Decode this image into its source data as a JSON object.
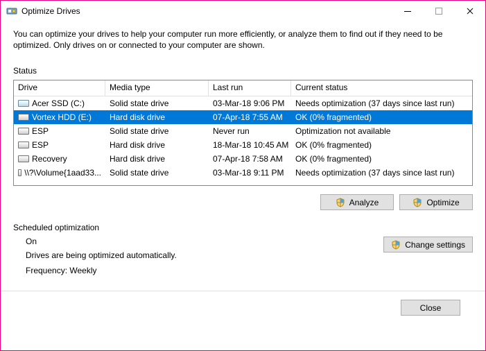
{
  "window": {
    "title": "Optimize Drives"
  },
  "intro": "You can optimize your drives to help your computer run more efficiently, or analyze them to find out if they need to be optimized. Only drives on or connected to your computer are shown.",
  "status": {
    "label": "Status",
    "columns": [
      "Drive",
      "Media type",
      "Last run",
      "Current status"
    ],
    "rows": [
      {
        "name": "Acer SSD (C:)",
        "media": "Solid state drive",
        "last": "03-Mar-18 9:06 PM",
        "status": "Needs optimization (37 days since last run)",
        "iconKind": "ssd",
        "selected": false
      },
      {
        "name": "Vortex HDD (E:)",
        "media": "Hard disk drive",
        "last": "07-Apr-18 7:55 AM",
        "status": "OK (0% fragmented)",
        "iconKind": "hdd",
        "selected": true
      },
      {
        "name": "ESP",
        "media": "Solid state drive",
        "last": "Never run",
        "status": "Optimization not available",
        "iconKind": "hdd",
        "selected": false
      },
      {
        "name": "ESP",
        "media": "Hard disk drive",
        "last": "18-Mar-18 10:45 AM",
        "status": "OK (0% fragmented)",
        "iconKind": "hdd",
        "selected": false
      },
      {
        "name": "Recovery",
        "media": "Hard disk drive",
        "last": "07-Apr-18 7:58 AM",
        "status": "OK (0% fragmented)",
        "iconKind": "hdd",
        "selected": false
      },
      {
        "name": "\\\\?\\Volume{1aad33...",
        "media": "Solid state drive",
        "last": "03-Mar-18 9:11 PM",
        "status": "Needs optimization (37 days since last run)",
        "iconKind": "hdd",
        "selected": false
      }
    ]
  },
  "buttons": {
    "analyze": "Analyze",
    "optimize": "Optimize",
    "change_settings": "Change settings",
    "close": "Close"
  },
  "scheduled": {
    "label": "Scheduled optimization",
    "on": "On",
    "desc": "Drives are being optimized automatically.",
    "freq": "Frequency: Weekly"
  }
}
